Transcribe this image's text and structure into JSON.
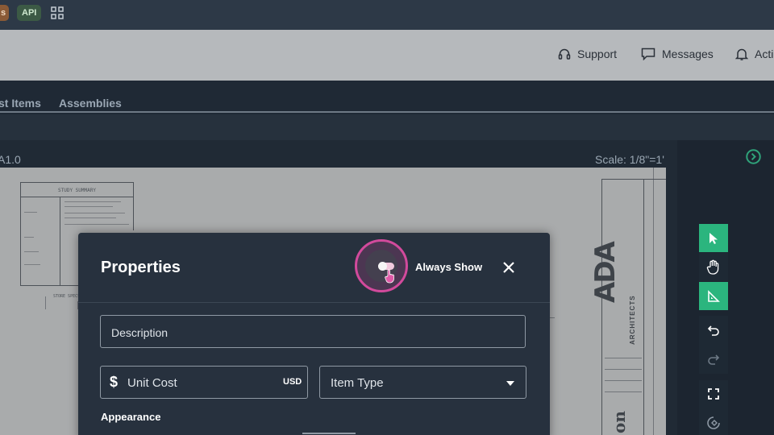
{
  "topbar": {
    "badge_left": "s",
    "badge_api": "API",
    "apps_icon": "grid-icon"
  },
  "header": {
    "support_label": "Support",
    "messages_label": "Messages",
    "activity_label": "Acti"
  },
  "tabs": [
    {
      "label": "st Items"
    },
    {
      "label": "Assemblies"
    }
  ],
  "sheet": {
    "name": "A1.0",
    "scale": "Scale: 1/8\"=1'"
  },
  "drawing": {
    "title_block_heading": "STUDY SUMMARY",
    "logo_main": "ADA",
    "logo_sub": "ARCHITECTS",
    "vertical_text": "on",
    "note_label": "STORE SPECS"
  },
  "toolbar": [
    {
      "name": "select-tool",
      "icon": "cursor-icon",
      "active": true
    },
    {
      "name": "pan-tool",
      "icon": "hand-icon",
      "active": false
    },
    {
      "name": "measure-tool",
      "icon": "ruler-triangle-icon",
      "active": true
    },
    {
      "name": "undo-tool",
      "icon": "undo-icon",
      "active": false
    },
    {
      "name": "redo-tool",
      "icon": "redo-icon",
      "active": false
    },
    {
      "name": "fit-tool",
      "icon": "fullscreen-icon",
      "active": false
    },
    {
      "name": "rotate-tool",
      "icon": "rotate-icon",
      "active": false
    }
  ],
  "modal": {
    "title": "Properties",
    "toggle_label": "Always Show",
    "toggle_on": true,
    "description_placeholder": "Description",
    "currency_symbol": "$",
    "unit_cost_placeholder": "Unit Cost",
    "currency": "USD",
    "item_type_placeholder": "Item Type",
    "appearance_label": "Appearance"
  },
  "colors": {
    "accent_green": "#2bb57e",
    "highlight_pink": "#d24a9c",
    "modal_bg": "#27313e"
  }
}
